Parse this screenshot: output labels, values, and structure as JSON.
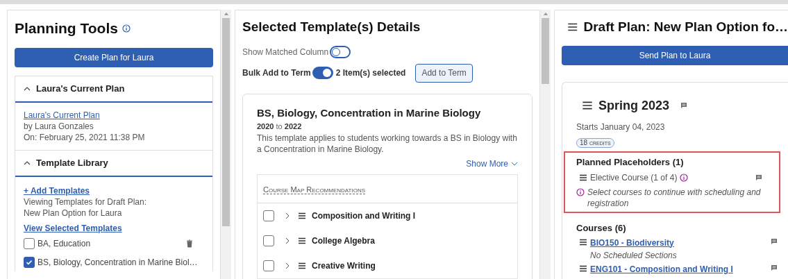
{
  "left": {
    "title": "Planning Tools",
    "create_button": "Create Plan for Laura",
    "sections": [
      {
        "title": "Laura's Current Plan",
        "expanded": true
      },
      {
        "title": "Template Library",
        "expanded": true
      }
    ],
    "current_plan": {
      "link": "Laura's Current Plan",
      "author": "by Laura Gonzales",
      "date": "On: February 25, 2021 11:38 PM"
    },
    "library": {
      "add_link": "+ Add Templates",
      "viewing": "Viewing Templates for Draft Plan:",
      "plan_name": "New Plan Option for Laura",
      "view_link": "View Selected Templates",
      "templates": [
        {
          "label": "BA, Education",
          "checked": false
        },
        {
          "label": "BS, Biology, Concentration in Marine Biol…",
          "checked": true
        }
      ]
    }
  },
  "middle": {
    "title": "Selected Template(s) Details",
    "show_matched": {
      "label": "Show Matched Column",
      "on": false
    },
    "bulk_add": {
      "label": "Bulk Add to Term",
      "on": true
    },
    "selected_count": "2 Item(s) selected",
    "add_button": "Add to Term",
    "template": {
      "name": "BS, Biology, Concentration in Marine Biology",
      "year_from": "2020",
      "year_sep": "to",
      "year_to": "2022",
      "description": "This template applies to students working towards a BS in Biology with a Concentration in Marine Biology.",
      "show_more": "Show More",
      "recommendations_title": "Course Map Recommendations",
      "courses": [
        {
          "name": "Composition and Writing I",
          "checked": false,
          "expanded": false
        },
        {
          "name": "College Algebra",
          "checked": false,
          "expanded": false
        },
        {
          "name": "Creative Writing",
          "checked": false,
          "expanded": false
        }
      ]
    }
  },
  "right": {
    "title": "Draft Plan: New Plan Option fo…",
    "send_button": "Send Plan to Laura",
    "term": {
      "name": "Spring 2023",
      "starts": "Starts January 04, 2023",
      "credits": "18 credits",
      "placeholders_title": "Planned Placeholders (1)",
      "placeholder": "Elective Course (1 of 4)",
      "warning": "Select courses to continue with scheduling and registration",
      "courses_title": "Courses (6)",
      "courses": [
        {
          "link": "BIO150 - Biodiversity",
          "note": "No Scheduled Sections"
        },
        {
          "link": "ENG101 - Composition and Writing I"
        }
      ]
    }
  }
}
